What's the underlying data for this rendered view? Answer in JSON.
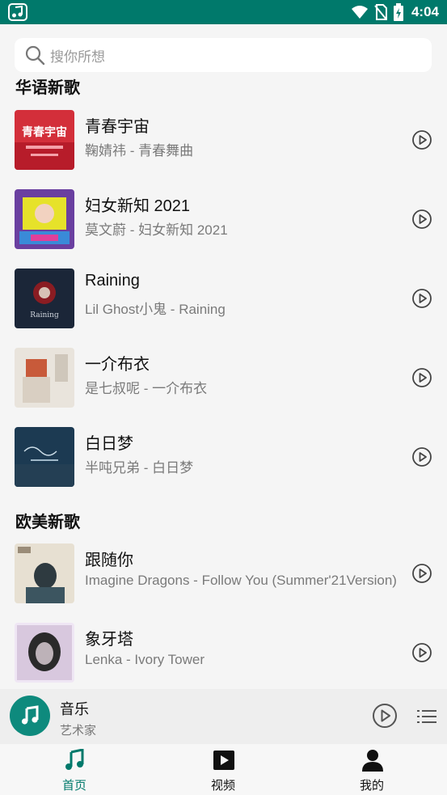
{
  "status_bar": {
    "time": "4:04"
  },
  "search": {
    "placeholder": "搜你所想"
  },
  "sections": [
    {
      "title": "华语新歌",
      "songs": [
        {
          "title": "青春宇宙",
          "subtitle": "鞠婧祎 - 青春舞曲",
          "cover_text": "青春宇宙"
        },
        {
          "title": "妇女新知 2021",
          "subtitle": "莫文蔚 - 妇女新知 2021"
        },
        {
          "title": "Raining",
          "subtitle": "Lil Ghost小鬼 - Raining",
          "cover_text": "Raining"
        },
        {
          "title": "一介布衣",
          "subtitle": "是七叔呢 - 一介布衣"
        },
        {
          "title": "白日梦",
          "subtitle": "半吨兄弟 - 白日梦"
        }
      ]
    },
    {
      "title": "欧美新歌",
      "songs": [
        {
          "title": "跟随你",
          "subtitle": "Imagine Dragons - Follow You (Summer'21Version)"
        },
        {
          "title": "象牙塔",
          "subtitle": "Lenka - Ivory Tower"
        }
      ]
    }
  ],
  "player": {
    "title": "音乐",
    "artist": "艺术家"
  },
  "nav": [
    {
      "label": "首页",
      "icon": "music-note-icon",
      "active": true
    },
    {
      "label": "视频",
      "icon": "video-play-icon",
      "active": false
    },
    {
      "label": "我的",
      "icon": "person-icon",
      "active": false
    }
  ],
  "colors": {
    "accent": "#00796b",
    "nav_active": "#00796b",
    "text_secondary": "#7a7a7a"
  }
}
